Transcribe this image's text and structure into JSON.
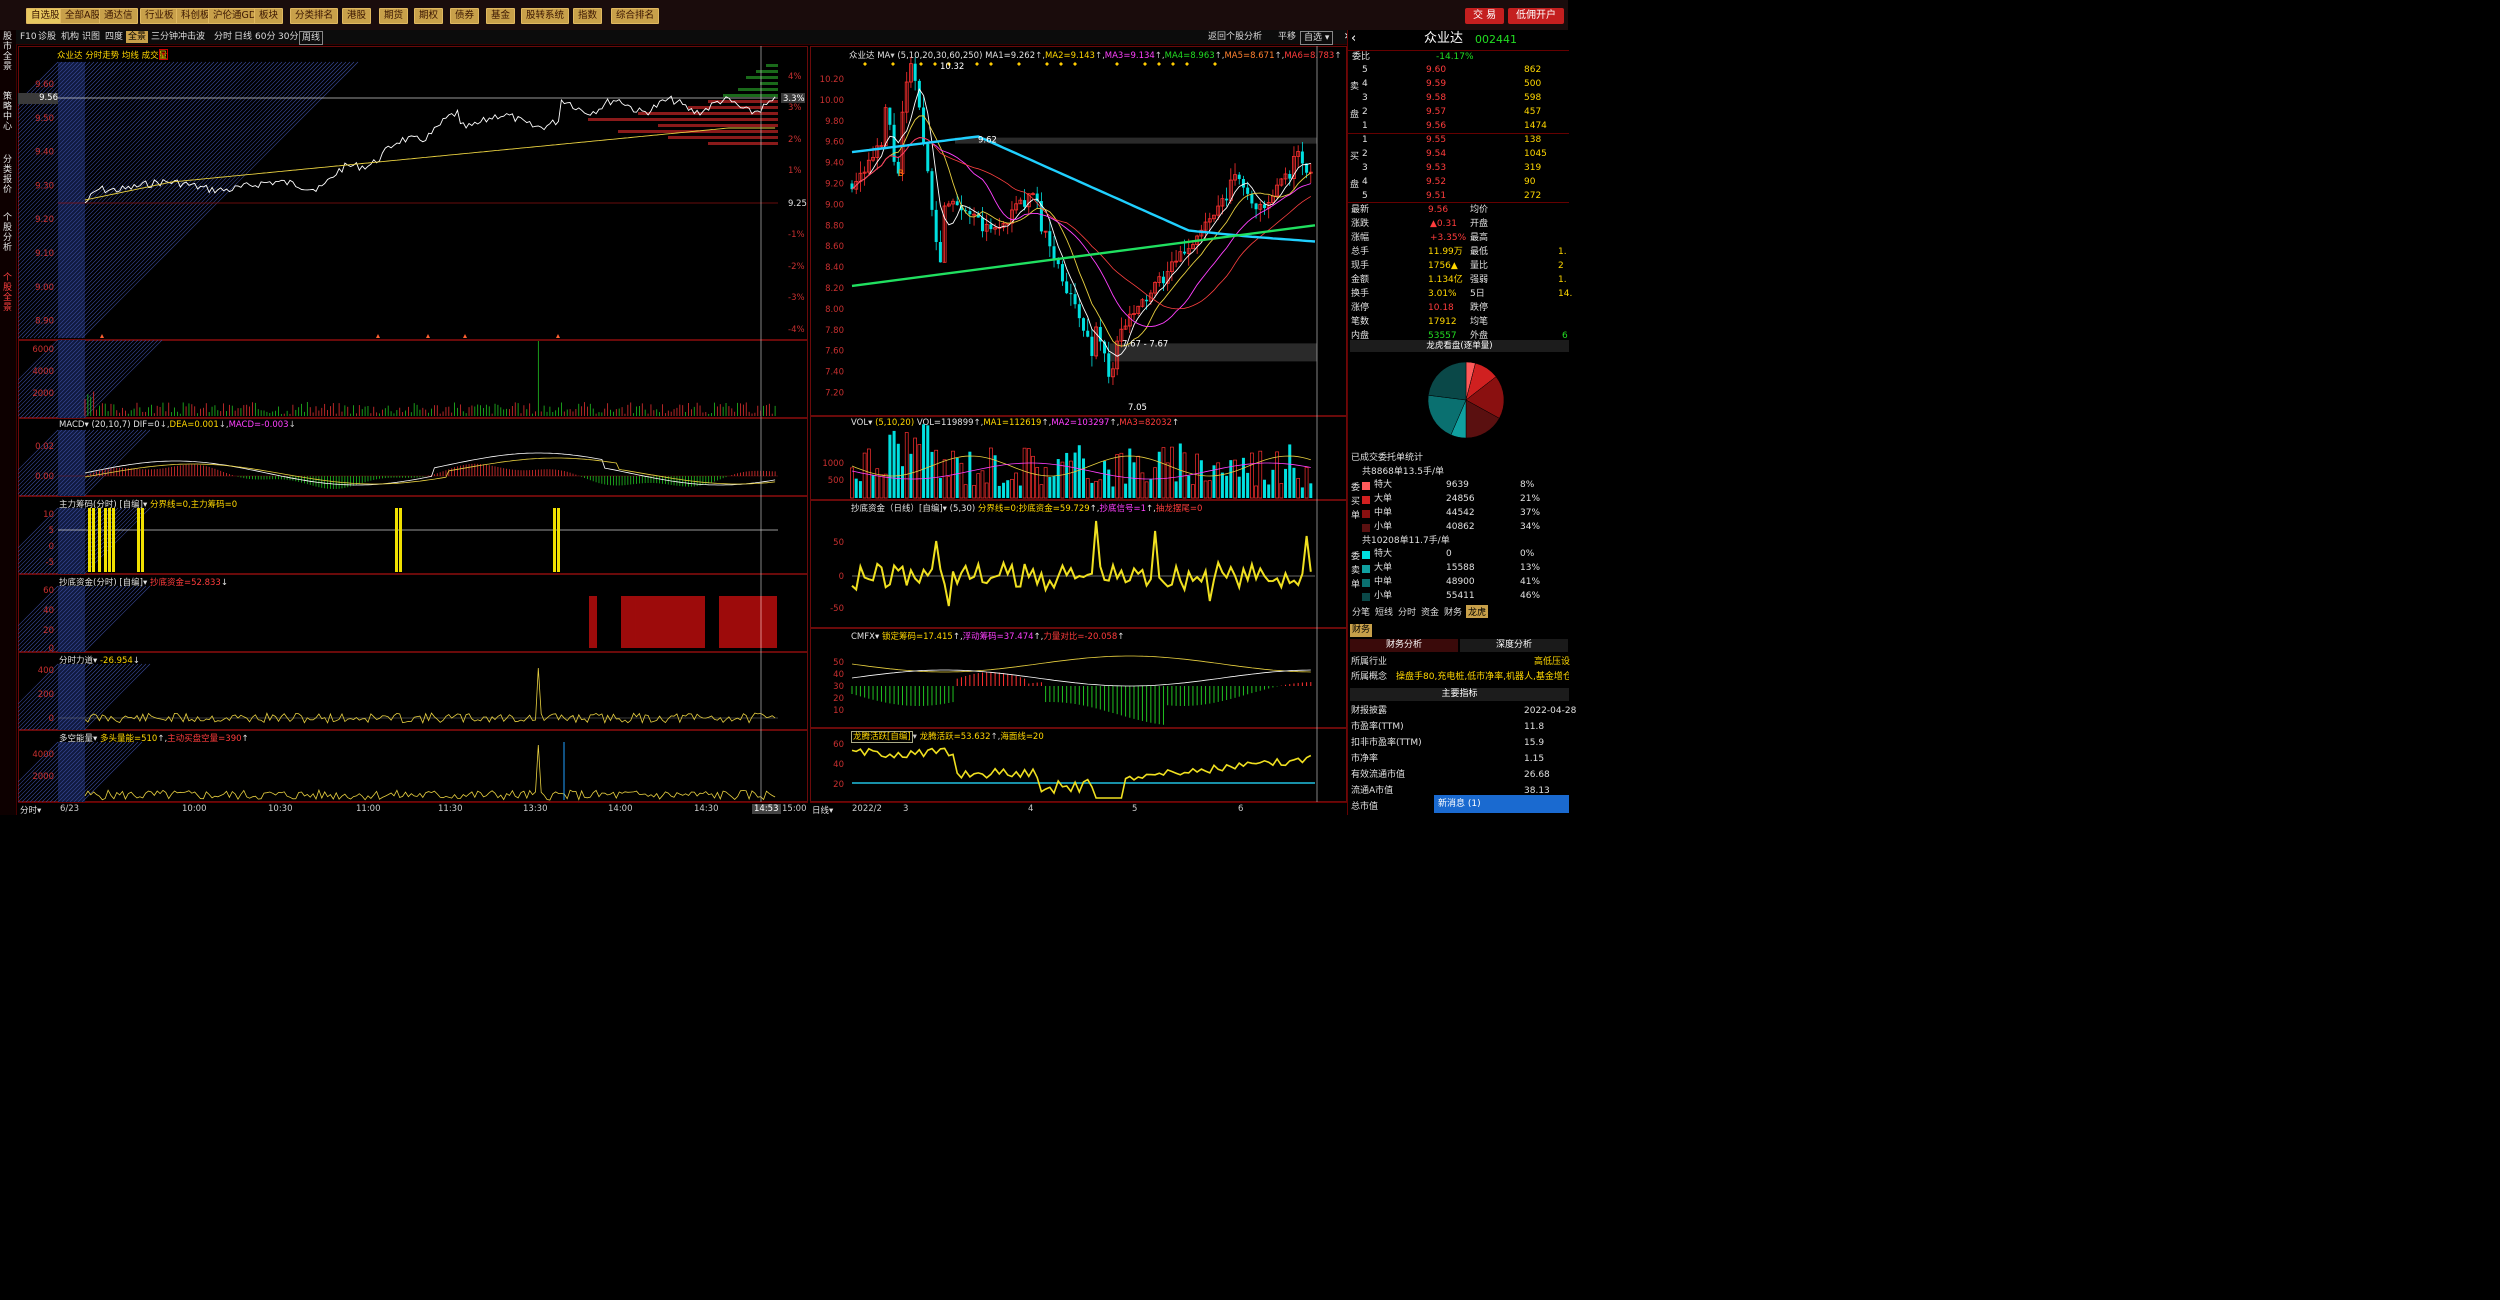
{
  "toolbar": {
    "items": [
      "自选股",
      "全部A股",
      "通达信",
      "行业板",
      "科创板",
      "沪伦通GDR",
      "板块",
      "分类排名",
      "港股",
      "期货",
      "期权",
      "债券",
      "基金",
      "股转系统",
      "指数",
      "综合排名"
    ],
    "trade": "交 易",
    "account": "低佣开户"
  },
  "left_tabs": [
    "股市全景",
    "策略中心",
    "分类报价",
    "个股分析",
    "个股全景"
  ],
  "subnav": {
    "items": [
      "F10",
      "诊股",
      "机构",
      "识图",
      "四度",
      "全景",
      "三分钟",
      "冲击波",
      "分时",
      "日线",
      "60分",
      "30分",
      "周线"
    ],
    "selected": "全景",
    "right": [
      "返回个股分析",
      "平移",
      "自选"
    ]
  },
  "intraday": {
    "title": "众业达 分时走势 均线 成交量",
    "price_label": "9.56",
    "y_left": [
      "9.60",
      "9.50",
      "9.40",
      "9.30",
      "9.20",
      "9.10",
      "9.00",
      "8.90"
    ],
    "y_right": [
      "4%",
      "3%",
      "2%",
      "1%",
      "9.25",
      "-1%",
      "-2%",
      "-3%",
      "-4%"
    ],
    "current_pct": "3.3%",
    "vol_ticks": [
      "6000",
      "4000",
      "2000"
    ],
    "macd_title": "MACD",
    "macd_params": "(20,10,7)",
    "macd_dif": "DIF=0",
    "macd_dea": "DEA=0.001",
    "macd_val": "MACD=-0.003",
    "macd_ticks": [
      "0.02",
      "0.00",
      "-0.02"
    ],
    "zlcm_title": "主力筹码(分时)",
    "zlcm_sub": "[自编]",
    "zlcm_vals": "分界线=0,主力筹码=0",
    "zlcm_ticks": [
      "10",
      "5",
      "0",
      "-5",
      "-10"
    ],
    "cdzj_title": "抄底资金(分时)",
    "cdzj_sub": "[自编]",
    "cdzj_val": "抄底资金=52.833",
    "cdzj_ticks": [
      "60",
      "40",
      "20",
      "0"
    ],
    "fsld_title": "分时力道",
    "fsld_val": "-26.954",
    "fsld_ticks": [
      "400",
      "200",
      "0",
      "-200"
    ],
    "dkln_title": "多空能量",
    "dkln_val1": "多头量能=510",
    "dkln_val2": "主动买盘空量=390",
    "dkln_ticks": [
      "4000",
      "2000"
    ],
    "x_labels": [
      "6/23",
      "10:00",
      "10:30",
      "11:00",
      "11:30",
      "13:30",
      "14:00",
      "14:30",
      "14:53",
      "15:00"
    ],
    "bottom_label": "分时"
  },
  "daily": {
    "title": "众业达",
    "ma_label": "MA",
    "ma_params": "(5,10,20,30,60,250)",
    "ma1": "MA1=9.262",
    "ma2": "MA2=9.143",
    "ma3": "MA3=9.134",
    "ma4": "MA4=8.963",
    "ma5": "MA5=8.671",
    "ma6": "MA6=8.783",
    "y_ticks": [
      "10.20",
      "10.00",
      "9.80",
      "9.60",
      "9.40",
      "9.20",
      "9.00",
      "8.80",
      "8.60",
      "8.40",
      "8.20",
      "8.00",
      "7.80",
      "7.60",
      "7.40",
      "7.20"
    ],
    "high_note": "10.32",
    "mid_note": "9.62",
    "low_note1": "7.67 - 7.67",
    "low_note2": "7.05",
    "vol_title": "VOL",
    "vol_params": "(5,10,20)",
    "vol_val": "VOL=119899",
    "vol_ma1": "MA1=112619",
    "vol_ma2": "MA2=103297",
    "vol_ma3": "MA3=82032",
    "vol_ticks": [
      "1000",
      "500"
    ],
    "cdzj_title": "抄底资金（日线）",
    "cdzj_sub": "[自编]",
    "cdzj_params": "(5,30)",
    "cdzj_val": "分界线=0;抄底资金=59.729",
    "cdzj_sig": "抄底信号=1",
    "cdzj_sig2": "抽龙摆尾=0",
    "cdzj_ticks": [
      "50",
      "0",
      "-50"
    ],
    "cmfx_title": "CMFX",
    "cmfx_v1": "锁定筹码=17.415",
    "cmfx_v2": "浮动筹码=37.474",
    "cmfx_v3": "力量对比=-20.058",
    "cmfx_ticks": [
      "50",
      "40",
      "30",
      "20",
      "10"
    ],
    "lthy_title": "龙腾活跃[自编]",
    "lthy_v1": "龙腾活跃=53.632",
    "lthy_v2": "海面线=20",
    "lthy_ticks": [
      "60",
      "40",
      "20",
      "0"
    ],
    "x_labels": [
      "2022/2",
      "3",
      "4",
      "5",
      "6"
    ],
    "bottom_label": "日线"
  },
  "quote": {
    "name": "众业达",
    "code": "002441",
    "weibi_label": "委比",
    "weibi": "-14.17%",
    "asks": [
      {
        "label": "5",
        "price": "9.60",
        "vol": "862"
      },
      {
        "label": "4",
        "price": "9.59",
        "vol": "500"
      },
      {
        "label": "3",
        "price": "9.58",
        "vol": "598"
      },
      {
        "label": "2",
        "price": "9.57",
        "vol": "457"
      },
      {
        "label": "1",
        "price": "9.56",
        "vol": "1474"
      }
    ],
    "bids": [
      {
        "label": "1",
        "price": "9.55",
        "vol": "138"
      },
      {
        "label": "2",
        "price": "9.54",
        "vol": "1045"
      },
      {
        "label": "3",
        "price": "9.53",
        "vol": "319"
      },
      {
        "label": "4",
        "price": "9.52",
        "vol": "90"
      },
      {
        "label": "5",
        "price": "9.51",
        "vol": "272"
      }
    ],
    "ask_side_labels": [
      "卖",
      "盘"
    ],
    "bid_side_labels": [
      "买",
      "盘"
    ],
    "stats": [
      {
        "k": "最新",
        "v": "9.56",
        "k2": "均价",
        "c": "red"
      },
      {
        "k": "涨跌",
        "v": "▲0.31",
        "k2": "开盘",
        "c": "red"
      },
      {
        "k": "涨幅",
        "v": "+3.35%",
        "k2": "最高",
        "c": "red"
      },
      {
        "k": "总手",
        "v": "11.99万",
        "k2": "最低",
        "c": "yel"
      },
      {
        "k": "现手",
        "v": "1756▲",
        "k2": "量比",
        "c": "yel"
      },
      {
        "k": "金额",
        "v": "1.134亿",
        "k2": "强弱",
        "c": "yel"
      },
      {
        "k": "换手",
        "v": "3.01%",
        "k2": "5日",
        "c": "yel"
      },
      {
        "k": "涨停",
        "v": "10.18",
        "k2": "跌停",
        "c": "red"
      },
      {
        "k": "笔数",
        "v": "17912",
        "k2": "均笔",
        "c": "yel"
      },
      {
        "k": "内盘",
        "v": "53557",
        "k2": "外盘",
        "c": "grn"
      }
    ],
    "stats_extra": [
      "1.",
      "2",
      "1.",
      "14."
    ],
    "outer_vol": "6",
    "pie_title": "龙虎看盘(逐单量)",
    "order_title": "已成交委托单统计",
    "buy_total": "共8868单13.5手/单",
    "sell_total": "共10208单11.7手/单",
    "buy_side": [
      "委",
      "买",
      "单"
    ],
    "sell_side": [
      "委",
      "卖",
      "单"
    ],
    "buy_rows": [
      {
        "k": "特大",
        "v": "9639",
        "p": "8%",
        "color": "#ff5a5a"
      },
      {
        "k": "大单",
        "v": "24856",
        "p": "21%",
        "color": "#d02020"
      },
      {
        "k": "中单",
        "v": "44542",
        "p": "37%",
        "color": "#8a1010"
      },
      {
        "k": "小单",
        "v": "40862",
        "p": "34%",
        "color": "#5a1010"
      }
    ],
    "sell_rows": [
      {
        "k": "特大",
        "v": "0",
        "p": "0%",
        "color": "#00e0e0"
      },
      {
        "k": "大单",
        "v": "15588",
        "p": "13%",
        "color": "#10a0a0"
      },
      {
        "k": "中单",
        "v": "48900",
        "p": "41%",
        "color": "#0a7070"
      },
      {
        "k": "小单",
        "v": "55411",
        "p": "46%",
        "color": "#0a4848"
      }
    ],
    "tabs": [
      "分笔",
      "短线",
      "分时",
      "资金",
      "财务",
      "龙虎"
    ],
    "tab_selected": "龙虎",
    "fin_tab": "财务",
    "fin_sub1": "财务分析",
    "fin_sub2": "深度分析",
    "industry_label": "所属行业",
    "industry": "高低压设",
    "concept_label": "所属概念",
    "concept": "操盘手80,充电桩,低市净率,机器人,基金增仓,智",
    "main_idx": "主要指标",
    "fin_rows": [
      {
        "k": "财报披露",
        "v": "2022-04-28"
      },
      {
        "k": "市盈率(TTM)",
        "v": "11.8"
      },
      {
        "k": "扣非市盈率(TTM)",
        "v": "15.9"
      },
      {
        "k": "市净率",
        "v": "1.15"
      },
      {
        "k": "有效流通市值",
        "v": "26.68"
      },
      {
        "k": "流通A市值",
        "v": "38.13"
      },
      {
        "k": "总市值",
        "v": ""
      }
    ],
    "news": "新消息 (1)"
  }
}
